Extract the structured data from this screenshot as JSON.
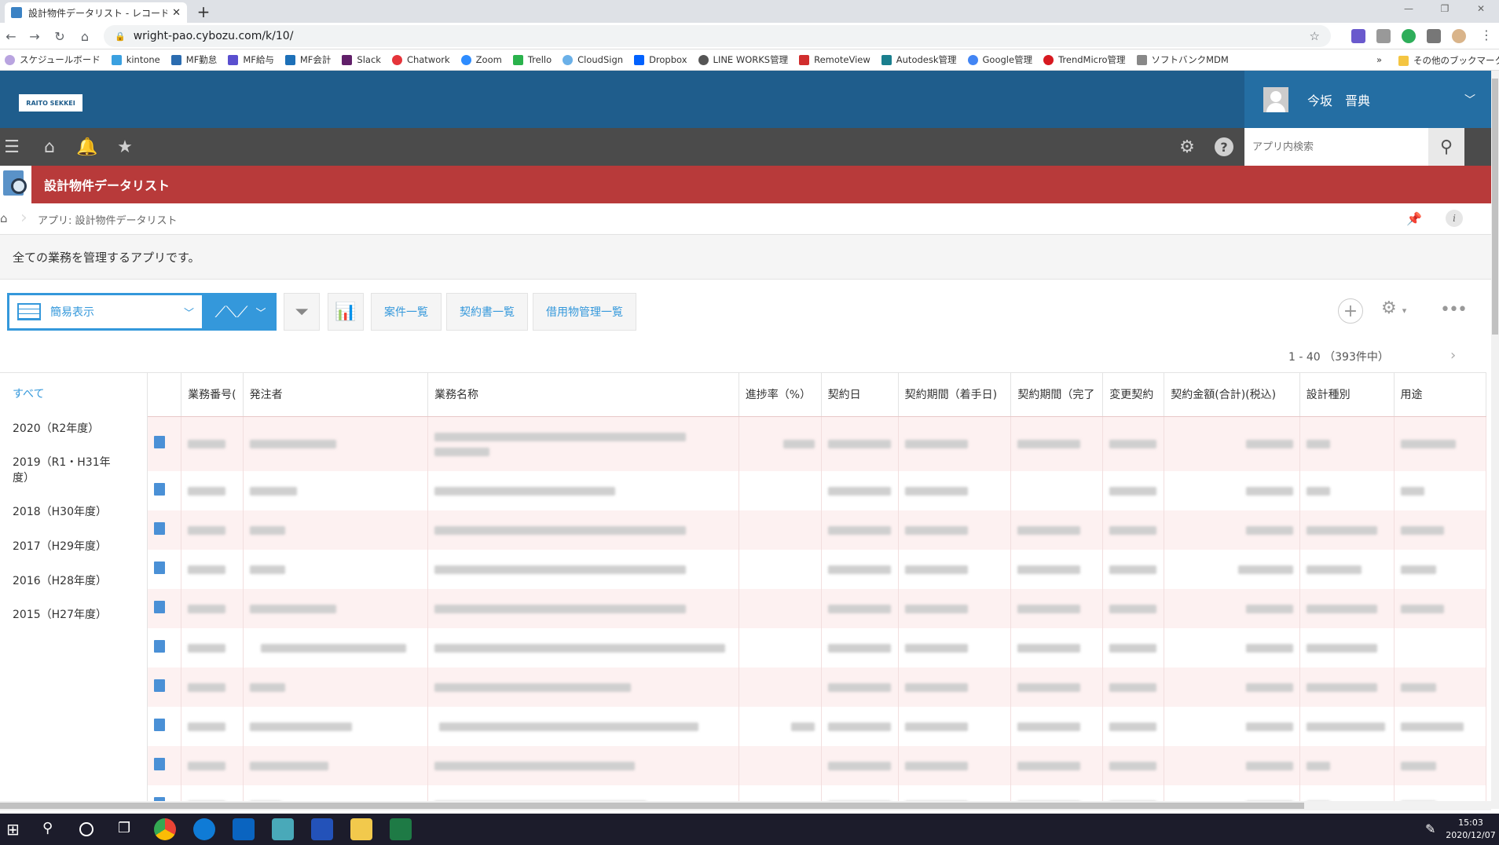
{
  "browser": {
    "tab_title": "設計物件データリスト - レコードの一覧",
    "tab_close": "✕",
    "new_tab": "+",
    "url": "wright-pao.cybozu.com/k/10/",
    "bookmarks": [
      "スケジュールボード",
      "kintone",
      "MF勤怠",
      "MF給与",
      "MF会計",
      "Slack",
      "Chatwork",
      "Zoom",
      "Trello",
      "CloudSign",
      "Dropbox",
      "LINE WORKS管理",
      "RemoteView",
      "Autodesk管理",
      "Google管理",
      "TrendMicro管理",
      "ソフトバンクMDM"
    ],
    "bookmarks_more": "»",
    "other_bookmarks": "その他のブックマーク"
  },
  "header": {
    "logo_text": "RAITO SEKKEI",
    "user_name": "今坂　晋典",
    "search_placeholder": "アプリ内検索"
  },
  "app": {
    "title": "設計物件データリスト",
    "breadcrumb": "アプリ: 設計物件データリスト",
    "description": "全ての業務を管理するアプリです。"
  },
  "toolbar": {
    "view_name": "簡易表示",
    "buttons": [
      "案件一覧",
      "契約書一覧",
      "借用物管理一覧"
    ],
    "pager": "1 - 40 （393件中）"
  },
  "filters": [
    {
      "label": "すべて"
    },
    {
      "label": "2020（R2年度）"
    },
    {
      "label": "2019（R1・H31年度）"
    },
    {
      "label": "2018（H30年度）"
    },
    {
      "label": "2017（H29年度）"
    },
    {
      "label": "2016（H28年度）"
    },
    {
      "label": "2015（H27年度）"
    }
  ],
  "table": {
    "columns": [
      "業務番号(",
      "発注者",
      "業務名称",
      "進捗率（%）",
      "契約日",
      "契約期間（着手日)",
      "契約期間（完了",
      "変更契約",
      "契約金額(合計)(税込)",
      "設計種別",
      "用途"
    ]
  },
  "taskbar": {
    "time": "15:03",
    "date": "2020/12/07"
  }
}
